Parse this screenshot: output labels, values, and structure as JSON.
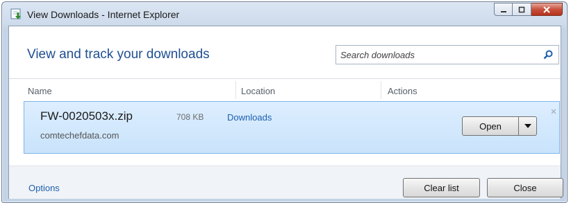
{
  "window": {
    "title": "View Downloads - Internet Explorer",
    "icon": "ie-downloads-icon"
  },
  "header": {
    "title": "View and track your downloads"
  },
  "search": {
    "placeholder": "Search downloads",
    "value": ""
  },
  "columns": [
    "Name",
    "Location",
    "Actions"
  ],
  "downloads": [
    {
      "file_name": "FW-0020503x.zip",
      "size": "708 KB",
      "location": "Downloads",
      "source": "comtechefdata.com",
      "action_label": "Open"
    }
  ],
  "footer": {
    "options_label": "Options",
    "clear_label": "Clear list",
    "close_label": "Close"
  },
  "colors": {
    "accent": "#1e4f91",
    "link": "#1e5fae",
    "row_highlight": "#c9e3fb",
    "row_border": "#7eb4ea"
  }
}
